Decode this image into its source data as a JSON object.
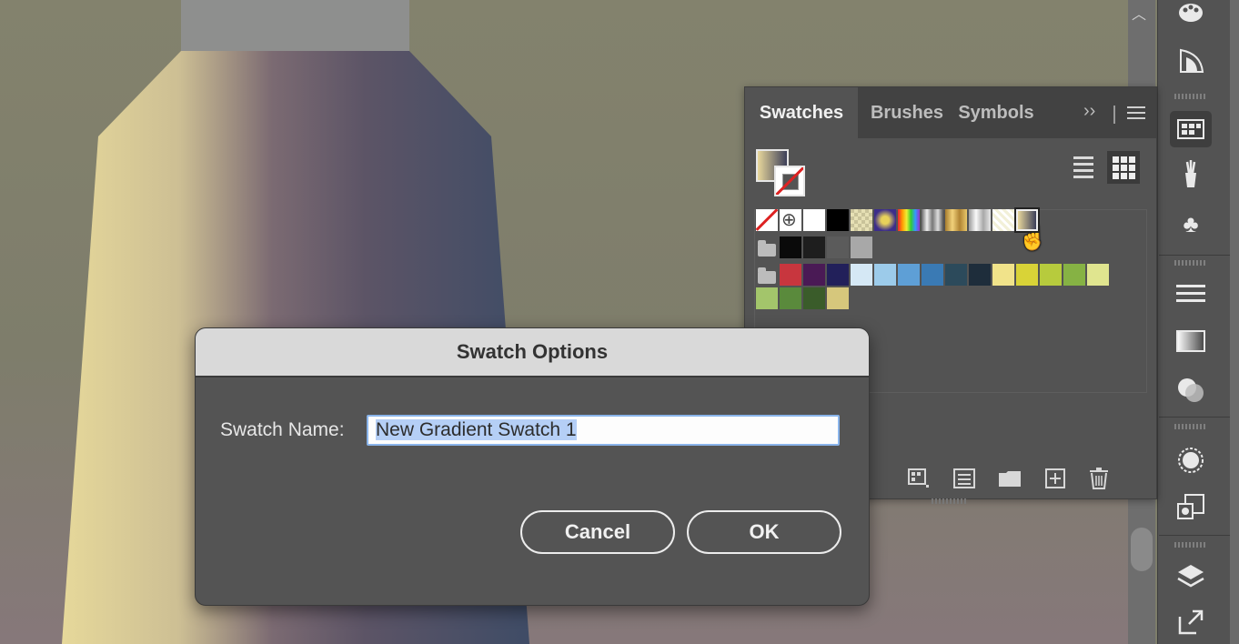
{
  "panel": {
    "tabs": [
      {
        "label": "Swatches"
      },
      {
        "label": "Brushes"
      },
      {
        "label": "Symbols"
      }
    ],
    "collapse_glyph": "››",
    "view_list_icon": "list-view-icon",
    "view_grid_icon": "grid-view-icon",
    "swatch_rows": {
      "row1": [
        "none",
        "registration",
        "#ffffff",
        "#000000",
        "pattern-check",
        "radial-gradient",
        "rainbow-gradient",
        "chrome-gradient",
        "gold-gradient",
        "silver-gradient",
        "pattern-light",
        "selected-gradient"
      ],
      "row2": [
        "#0a0a0a",
        "#1e1e1e",
        "#5b5b5b",
        "#a8a8a8"
      ],
      "row3": [
        "#c8363e",
        "#4a1a55",
        "#22205a",
        "#d5e8f5",
        "#9ccbea",
        "#5e9fd6",
        "#3a7ab4",
        "#2c4a5b",
        "#1e2d3b",
        "#f1e38a",
        "#d9d337",
        "#b7cb3d",
        "#86b244",
        "#e0e58f"
      ],
      "row4": [
        "#a3c56b",
        "#5a8a3c",
        "#3a5c2a",
        "#d6c77c"
      ]
    },
    "bottom_icons": [
      "swatch-library-icon",
      "show-kinds-icon",
      "new-group-icon",
      "new-swatch-icon",
      "delete-icon"
    ]
  },
  "dialog": {
    "title": "Swatch Options",
    "name_label": "Swatch Name:",
    "name_value": "New Gradient Swatch 1",
    "cancel_label": "Cancel",
    "ok_label": "OK"
  },
  "tools": [
    "color-palette-icon",
    "color-guide-icon",
    "swatches-icon",
    "brushes-icon",
    "symbols-icon",
    "stroke-icon",
    "gradient-icon",
    "transparency-icon",
    "appearance-icon",
    "graphic-styles-icon",
    "layers-icon",
    "asset-export-icon"
  ],
  "colors": {
    "panel_bg": "#535353",
    "dialog_title_bg": "#d9d9d9",
    "selection": "#b5cff6",
    "accent_stroke": "#dd2222"
  }
}
